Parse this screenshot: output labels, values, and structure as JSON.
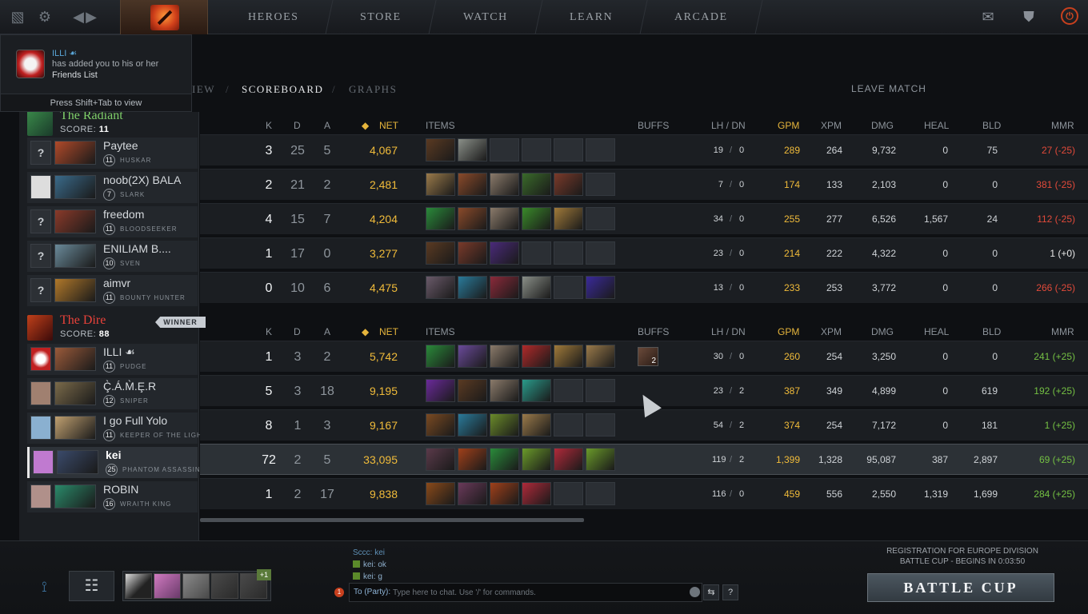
{
  "nav": {
    "tabs": [
      "HEROES",
      "STORE",
      "WATCH",
      "LEARN",
      "ARCADE"
    ]
  },
  "notification": {
    "name": "ILLI ☙",
    "line1": "has added you to his or her",
    "line2": "Friends List",
    "hint": "Press Shift+Tab to view"
  },
  "subtabs": {
    "overview_partial": "IEW",
    "scoreboard": "SCOREBOARD",
    "graphs": "GRAPHS",
    "separator": "/"
  },
  "leave_label": "LEAVE MATCH",
  "columns": {
    "k": "K",
    "d": "D",
    "a": "A",
    "net": "NET",
    "items": "ITEMS",
    "buffs": "BUFFS",
    "lhdn": "LH / DN",
    "gpm": "GPM",
    "xpm": "XPM",
    "dmg": "DMG",
    "heal": "HEAL",
    "bld": "BLD",
    "mmr": "MMR"
  },
  "radiant": {
    "name": "The Radiant",
    "score_label": "SCORE:",
    "score": "11",
    "color": "#7fd06a",
    "players": [
      {
        "avatar": "?",
        "name": "Paytee",
        "level": "11",
        "hero": "HUSKAR",
        "k": "3",
        "d": "25",
        "a": "5",
        "net": "4,067",
        "lh": "19",
        "dn": "0",
        "gpm": "289",
        "xpm": "264",
        "dmg": "9,732",
        "heal": "0",
        "bld": "75",
        "mmr": "27 (-25)",
        "mmr_sign": "neg",
        "items": [
          "#5a3a22",
          "#8a8f88",
          "",
          "",
          "",
          ""
        ]
      },
      {
        "avatar": "",
        "name": "noob(2X) BALA",
        "level": "7",
        "hero": "SLARK",
        "k": "2",
        "d": "21",
        "a": "2",
        "net": "2,481",
        "lh": "7",
        "dn": "0",
        "gpm": "174",
        "xpm": "133",
        "dmg": "2,103",
        "heal": "0",
        "bld": "0",
        "mmr": "381 (-25)",
        "mmr_sign": "neg",
        "items": [
          "#9a7a4a",
          "#8a4a2a",
          "#8a7a6a",
          "#3a6a2a",
          "#7a3a2a",
          ""
        ]
      },
      {
        "avatar": "?",
        "name": "freedom",
        "level": "11",
        "hero": "BLOODSEEKER",
        "k": "4",
        "d": "15",
        "a": "7",
        "net": "4,204",
        "lh": "34",
        "dn": "0",
        "gpm": "255",
        "xpm": "277",
        "dmg": "6,526",
        "heal": "1,567",
        "bld": "24",
        "mmr": "112 (-25)",
        "mmr_sign": "neg",
        "items": [
          "#2a8a3a",
          "#8a4a2a",
          "#8a7a6a",
          "#3a8a2a",
          "#a07a3a",
          ""
        ]
      },
      {
        "avatar": "?",
        "name": "ENILIAM B....",
        "level": "10",
        "hero": "SVEN",
        "k": "1",
        "d": "17",
        "a": "0",
        "net": "3,277",
        "lh": "23",
        "dn": "0",
        "gpm": "214",
        "xpm": "222",
        "dmg": "4,322",
        "heal": "0",
        "bld": "0",
        "mmr": "1 (+0)",
        "mmr_sign": "zero",
        "items": [
          "#5a3a22",
          "#7a3a2a",
          "#4a2a7a",
          "",
          "",
          ""
        ]
      },
      {
        "avatar": "?",
        "name": "aimvr",
        "level": "11",
        "hero": "BOUNTY HUNTER",
        "k": "0",
        "d": "10",
        "a": "6",
        "net": "4,475",
        "lh": "13",
        "dn": "0",
        "gpm": "233",
        "xpm": "253",
        "dmg": "3,772",
        "heal": "0",
        "bld": "0",
        "mmr": "266 (-25)",
        "mmr_sign": "neg",
        "items": [
          "#6a5a6a",
          "#2a7a9a",
          "#8a2a3a",
          "#8a8f88",
          "",
          "#3a2a9a"
        ]
      }
    ]
  },
  "dire": {
    "name": "The Dire",
    "score_label": "SCORE:",
    "score": "88",
    "winner": "WINNER",
    "color": "#e8423a",
    "players": [
      {
        "avatar": "",
        "name": "ILLI ☙",
        "level": "11",
        "hero": "PUDGE",
        "k": "1",
        "d": "3",
        "a": "2",
        "net": "5,742",
        "lh": "30",
        "dn": "0",
        "gpm": "260",
        "xpm": "254",
        "dmg": "3,250",
        "heal": "0",
        "bld": "0",
        "mmr": "241 (+25)",
        "mmr_sign": "pos",
        "items": [
          "#2a8a3a",
          "#6a4a9a",
          "#8a7a6a",
          "#b02a2a",
          "#a07a3a",
          "#9a7a4a"
        ],
        "buff": "2"
      },
      {
        "avatar": "",
        "name": "Ç̀.Á.M̀.Ȩ.R",
        "level": "12",
        "hero": "SNIPER",
        "k": "5",
        "d": "3",
        "a": "18",
        "net": "9,195",
        "lh": "23",
        "dn": "2",
        "gpm": "387",
        "xpm": "349",
        "dmg": "4,899",
        "heal": "0",
        "bld": "619",
        "mmr": "192 (+25)",
        "mmr_sign": "pos",
        "items": [
          "#6a2a9a",
          "#5a3a22",
          "#8a7a6a",
          "#2a9a8a",
          "",
          ""
        ]
      },
      {
        "avatar": "",
        "name": "I go Full Yolo",
        "level": "11",
        "hero": "KEEPER OF THE LIGHT",
        "k": "8",
        "d": "1",
        "a": "3",
        "net": "9,167",
        "lh": "54",
        "dn": "2",
        "gpm": "374",
        "xpm": "254",
        "dmg": "7,172",
        "heal": "0",
        "bld": "181",
        "mmr": "1 (+25)",
        "mmr_sign": "pos",
        "items": [
          "#7a4a22",
          "#2a7a9a",
          "#6a8a2a",
          "#9a7a4a",
          "",
          ""
        ]
      },
      {
        "avatar": "",
        "name": "kei",
        "level": "25",
        "hero": "PHANTOM ASSASSIN",
        "k": "72",
        "d": "2",
        "a": "5",
        "net": "33,095",
        "lh": "119",
        "dn": "2",
        "gpm": "1,399",
        "xpm": "1,328",
        "dmg": "95,087",
        "heal": "387",
        "bld": "2,897",
        "mmr": "69 (+25)",
        "mmr_sign": "pos",
        "selected": true,
        "items": [
          "#5a3a4a",
          "#a0401a",
          "#2a8a3a",
          "#6a9a2a",
          "#b02a3a",
          "#6a9a2a"
        ]
      },
      {
        "avatar": "",
        "name": "ROBIN",
        "level": "16",
        "hero": "WRAITH KING",
        "k": "1",
        "d": "2",
        "a": "17",
        "net": "9,838",
        "lh": "116",
        "dn": "0",
        "gpm": "459",
        "xpm": "556",
        "dmg": "2,550",
        "heal": "1,319",
        "bld": "1,699",
        "mmr": "284 (+25)",
        "mmr_sign": "pos",
        "items": [
          "#8a4a1a",
          "#6a3a5a",
          "#a0401a",
          "#b02a3a",
          "",
          ""
        ]
      }
    ]
  },
  "chat": {
    "system": "Sccc: kei",
    "messages": [
      "kei: ok",
      "kei: g"
    ],
    "badge": "1",
    "to": "To (Party):",
    "placeholder": "Type here to chat. Use '/' for commands.",
    "help": "?"
  },
  "party": {
    "extra": "+1"
  },
  "battlecup": {
    "line1": "REGISTRATION FOR EUROPE DIVISION",
    "line2": "BATTLE CUP - BEGINS IN 0:03:50",
    "button": "BATTLE CUP"
  }
}
